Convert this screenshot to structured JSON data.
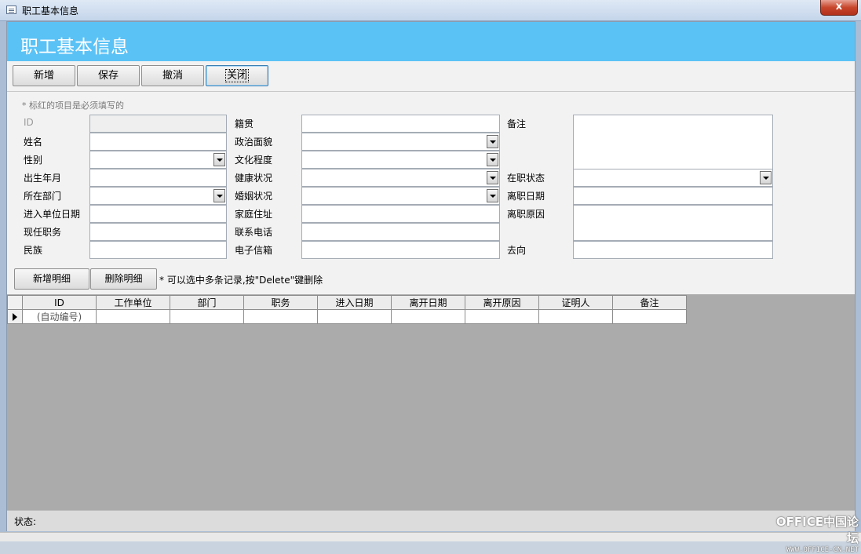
{
  "window": {
    "title": "职工基本信息",
    "close_symbol": "x"
  },
  "form": {
    "title": "职工基本信息"
  },
  "toolbar": {
    "add": "新增",
    "save": "保存",
    "undo": "撤消",
    "close": "关闭"
  },
  "hint": "* 标红的项目是必须填写的",
  "col1": {
    "id": "ID",
    "name": "姓名",
    "gender": "性别",
    "birth": "出生年月",
    "dept": "所在部门",
    "join_date": "进入单位日期",
    "position": "现任职务",
    "ethnicity": "民族"
  },
  "col2": {
    "native_place": "籍贯",
    "political_status": "政治面貌",
    "education": "文化程度",
    "health": "健康状况",
    "marital": "婚姻状况",
    "address": "家庭住址",
    "phone": "联系电话",
    "email": "电子信箱"
  },
  "col3": {
    "remark": "备注",
    "employment_status": "在职状态",
    "leave_date": "离职日期",
    "leave_reason": "离职原因",
    "destination": "去向"
  },
  "subform": {
    "add_detail": "新增明细",
    "delete_detail": "删除明细",
    "hint": "* 可以选中多条记录,按\"Delete\"键删除",
    "columns": [
      "ID",
      "工作单位",
      "部门",
      "职务",
      "进入日期",
      "离开日期",
      "离开原因",
      "证明人",
      "备注"
    ],
    "new_row_id": "(自动编号)"
  },
  "status": {
    "label": "状态:"
  },
  "watermark": {
    "line1": "OFFICE中国论坛",
    "line2": "WWW.OFFICE-CN.NET"
  }
}
